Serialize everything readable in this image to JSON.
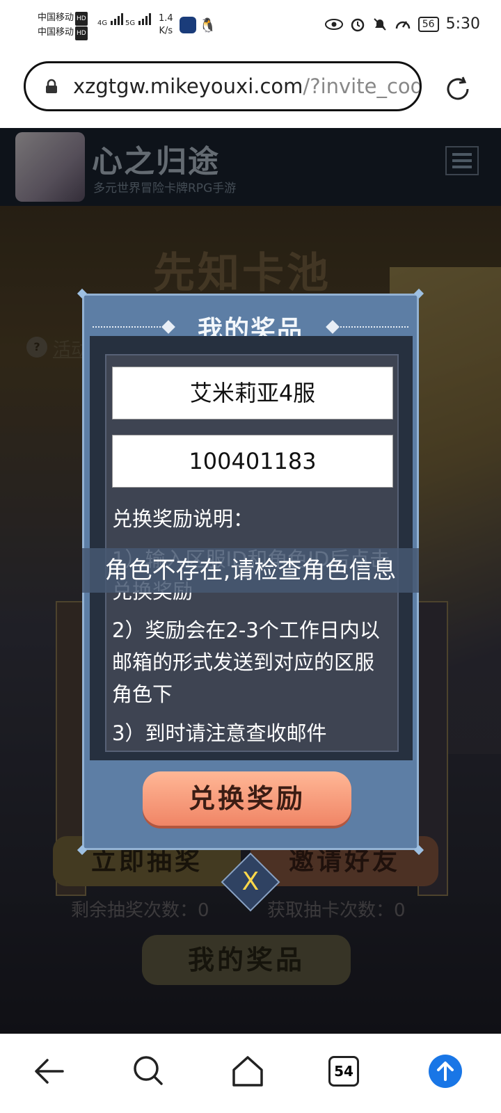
{
  "status_bar": {
    "carrier1": "中国移动",
    "carrier2": "中国移动",
    "hd": "HD",
    "net1": "4G",
    "net2": "5G",
    "speed_value": "1.4",
    "speed_unit": "K/s",
    "battery": "56",
    "time": "5:30",
    "icons": [
      "eye-icon",
      "alarm-icon",
      "mute-icon",
      "speedometer-icon",
      "battery-icon"
    ]
  },
  "browser": {
    "url_host": "xzgtgw.mikeyouxi.com",
    "url_path": "/?invite_cod",
    "tab_count": "54"
  },
  "site": {
    "title": "心之归途",
    "subtitle": "多元世界冒险卡牌RPG手游",
    "pool_title": "先知卡池",
    "help_text": "活动",
    "draw_button": "立即抽奖",
    "invite_button": "邀请好友",
    "remaining_label": "剩余抽奖次数：0",
    "obtain_label": "获取抽卡次数：0",
    "my_prizes_button": "我的奖品",
    "close_symbol": "X"
  },
  "modal": {
    "title": "我的奖品",
    "server_value": "艾米莉亚4服",
    "role_id_value": "100401183",
    "instructions_title": "兑换奖励说明：",
    "instruction_1": "1）输入区服ID和角色ID后点击兑换奖励",
    "instruction_2": "2）奖励会在2-3个工作日内以邮箱的形式发送到对应的区服角色下",
    "instruction_3": "3）到时请注意查收邮件",
    "redeem_button": "兑换奖励"
  },
  "toast": {
    "message": "角色不存在,请检查角色信息"
  },
  "colors": {
    "modal_bg": "#5d7ea5",
    "redeem_btn": "#f08566",
    "toast_bg": "#465872",
    "nav_accent": "#1976e6"
  }
}
